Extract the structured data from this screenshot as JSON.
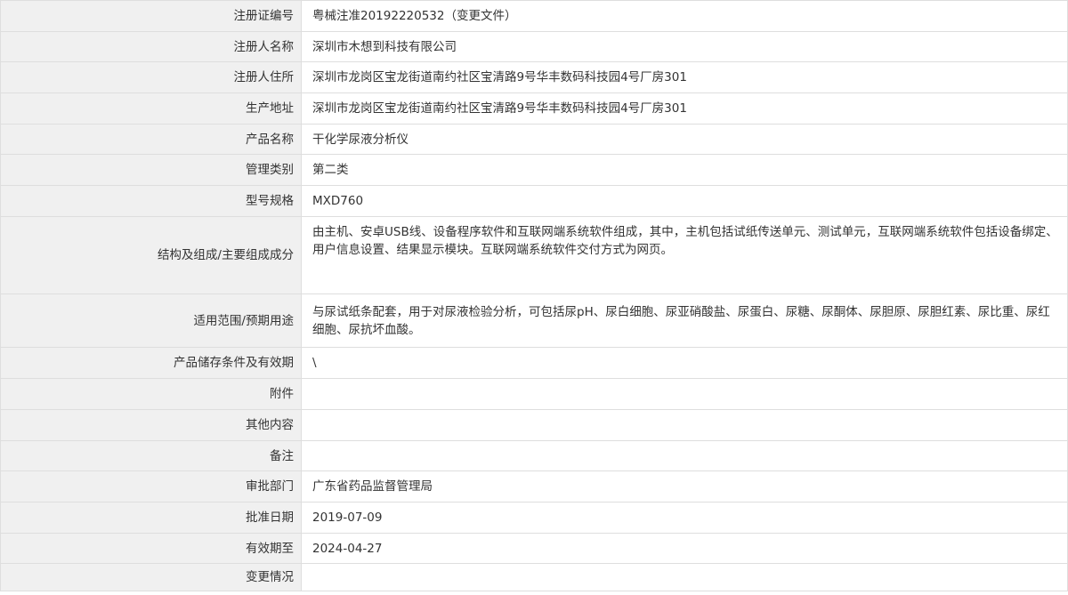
{
  "rows": [
    {
      "label": "注册证编号",
      "value": "粤械注准20192220532（变更文件）"
    },
    {
      "label": "注册人名称",
      "value": "深圳市木想到科技有限公司"
    },
    {
      "label": "注册人住所",
      "value": "深圳市龙岗区宝龙街道南约社区宝清路9号华丰数码科技园4号厂房301"
    },
    {
      "label": "生产地址",
      "value": "深圳市龙岗区宝龙街道南约社区宝清路9号华丰数码科技园4号厂房301"
    },
    {
      "label": "产品名称",
      "value": "干化学尿液分析仪"
    },
    {
      "label": "管理类别",
      "value": "第二类"
    },
    {
      "label": "型号规格",
      "value": "MXD760"
    },
    {
      "label": "结构及组成/主要组成成分",
      "value": "由主机、安卓USB线、设备程序软件和互联网端系统软件组成，其中，主机包括试纸传送单元、测试单元，互联网端系统软件包括设备绑定、用户信息设置、结果显示模块。互联网端系统软件交付方式为网页。"
    },
    {
      "label": "适用范围/预期用途",
      "value": "与尿试纸条配套，用于对尿液检验分析，可包括尿pH、尿白细胞、尿亚硝酸盐、尿蛋白、尿糖、尿酮体、尿胆原、尿胆红素、尿比重、尿红细胞、尿抗坏血酸。"
    },
    {
      "label": "产品储存条件及有效期",
      "value": "\\"
    },
    {
      "label": "附件",
      "value": ""
    },
    {
      "label": "其他内容",
      "value": ""
    },
    {
      "label": "备注",
      "value": ""
    },
    {
      "label": "审批部门",
      "value": "广东省药品监督管理局"
    },
    {
      "label": "批准日期",
      "value": "2019-07-09"
    },
    {
      "label": "有效期至",
      "value": "2024-04-27"
    },
    {
      "label": "变更情况",
      "value": ""
    }
  ]
}
